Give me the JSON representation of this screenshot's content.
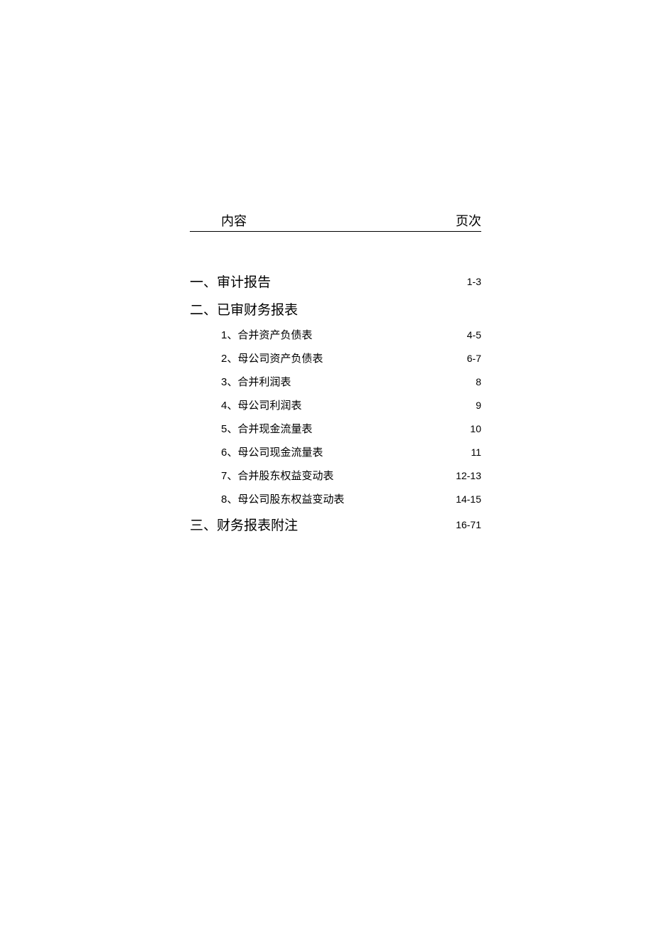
{
  "header": {
    "content_label": "内容",
    "page_label": "页次"
  },
  "sections": [
    {
      "title": "一、审计报告",
      "pages": "1-3"
    },
    {
      "title": "二、已审财务报表",
      "pages": "",
      "items": [
        {
          "number": "1",
          "label": "、合并资产负债表",
          "pages": "4-5"
        },
        {
          "number": "2",
          "label": "、母公司资产负债表",
          "pages": "6-7"
        },
        {
          "number": "3",
          "label": "、合并利润表",
          "pages": "8"
        },
        {
          "number": "4",
          "label": "、母公司利润表",
          "pages": "9"
        },
        {
          "number": "5",
          "label": "、合并现金流量表",
          "pages": "10"
        },
        {
          "number": "6",
          "label": "、母公司现金流量表",
          "pages": "11"
        },
        {
          "number": "7",
          "label": "、合并股东权益变动表",
          "pages": "12-13"
        },
        {
          "number": "8",
          "label": "、母公司股东权益变动表",
          "pages": "14-15"
        }
      ]
    },
    {
      "title": "三、财务报表附注",
      "pages": "16-71"
    }
  ]
}
